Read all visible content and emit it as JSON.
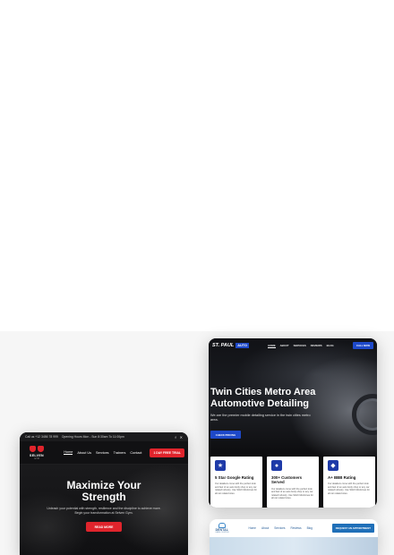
{
  "gym_site": {
    "topbar": {
      "phone": "Call us +12 3456 78 999",
      "hours": "Opening Hours Mon - Sun 8:30am To 11:00pm",
      "social_icons": [
        "facebook-icon",
        "twitter-icon"
      ]
    },
    "logo": {
      "name": "SELVEN",
      "sub": "GYM"
    },
    "nav": [
      "Home",
      "About Us",
      "Services",
      "Trainers",
      "Contact"
    ],
    "cta": "1 DAY FREE TRIAL",
    "hero": {
      "headline_line1": "Maximize Your",
      "headline_line2": "Strength",
      "tagline": "Unleash your potential with strength, resilience and the discipline to achieve more. Begin your transformation at Selven Gym.",
      "button": "READ MORE"
    },
    "colors": {
      "accent": "#e0242c",
      "background": "#0b0b0d"
    }
  },
  "auto_site": {
    "logo": {
      "part1": "ST. PAUL",
      "part2": "AUTO"
    },
    "nav": [
      "HOME",
      "ABOUT",
      "SERVICES",
      "REVIEWS",
      "BLOG"
    ],
    "call": "CALL NOW",
    "hero": {
      "headline_line1": "Twin Cities Metro Area",
      "headline_line2": "Automotive Detailing",
      "tagline": "We are the premier mobile detailing service in the twin cities metro area.",
      "button": "CHECK PRICING"
    },
    "features": [
      {
        "icon": "star-icon",
        "title": "5 Star Google Rating",
        "desc": "Our detailers come with the perfect look and feel of an auto body shop or any car related industry. Use Stitch Mockimes for all car related sites."
      },
      {
        "icon": "user-icon",
        "title": "300+ Customers Served",
        "desc": "Our detailers come with the perfect look and feel of an auto body shop or any car related industry. Use Stitch Mockimes for all car related sites."
      },
      {
        "icon": "badge-icon",
        "title": "A+ BBB Rating",
        "desc": "Our detailers come with the perfect look and feel of an auto body shop or any car related industry. Use Stitch Mockimes for all car related sites."
      }
    ],
    "colors": {
      "accent": "#1e49c9"
    }
  },
  "dental_site": {
    "logo": {
      "name": "DENTAL",
      "sub": "CARE CENTER"
    },
    "nav": [
      "Home",
      "About",
      "Services",
      "Reviews",
      "Blog"
    ],
    "cta": "REQUEST AN APPOINTMENT",
    "colors": {
      "accent": "#1f6fb8"
    }
  }
}
